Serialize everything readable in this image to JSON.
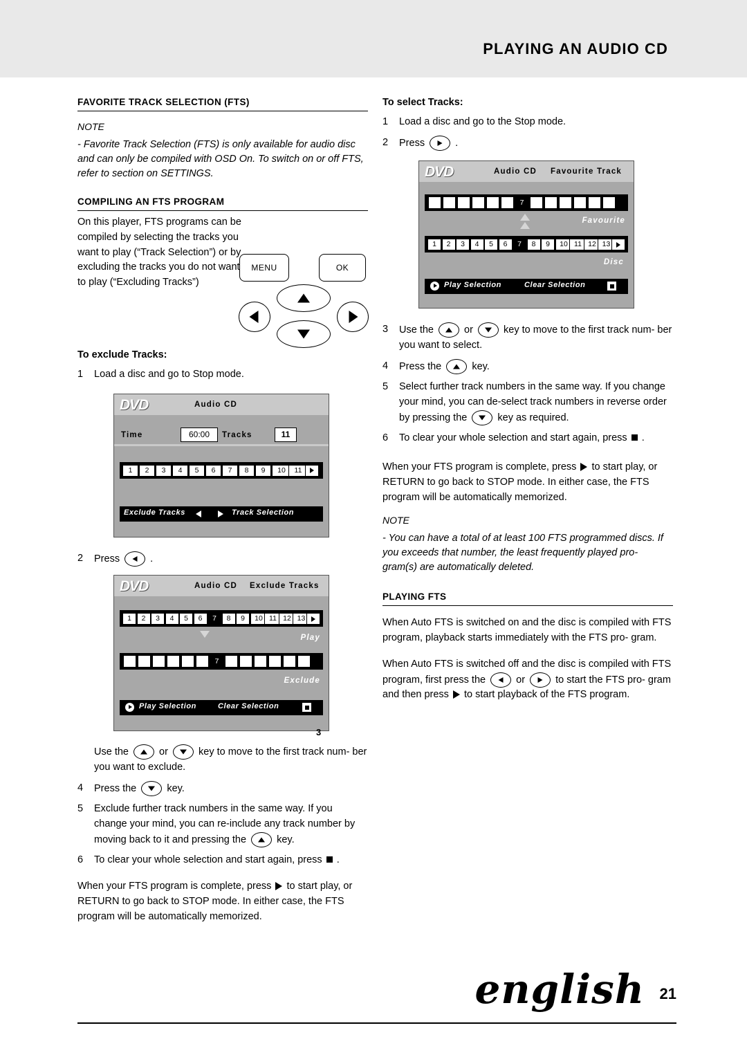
{
  "header": {
    "title": "PLAYING AN AUDIO CD"
  },
  "footer": {
    "language": "english",
    "page": "21"
  },
  "left": {
    "section1_title": "FAVORITE TRACK SELECTION (FTS)",
    "note_label": "NOTE",
    "note_body": "- Favorite Track Selection (FTS) is only available for audio disc and can only be compiled with OSD On. To switch on or off FTS, refer to section on SETTINGS.",
    "section2_title": "COMPILING AN FTS PROGRAM",
    "intro": "On this player, FTS programs can be compiled by selecting the tracks you want to play (“Track Selection”) or by excluding the tracks you do not want to play (“Excluding Tracks”)",
    "remote": {
      "menu": "MENU",
      "ok": "OK"
    },
    "sub1": "To exclude Tracks:",
    "step1_num": "1",
    "step1_text": "Load a disc and go to Stop mode.",
    "step2_num": "2",
    "step2_text": "Press",
    "step2_after": ".",
    "step3_num": "3",
    "step3_a": "Use the",
    "step3_or": "or",
    "step3_b": "key to move to the first track num- ber you want to exclude.",
    "step4_num": "4",
    "step4_a": "Press the",
    "step4_b": "key.",
    "step5_num": "5",
    "step5_a": "Exclude further track numbers in the same way. If you change your mind, you can re-include any track number by moving back to it and pressing the",
    "step5_b": "key.",
    "step6_num": "6",
    "step6_a": "To clear your whole selection and start again, press",
    "step6_b": ".",
    "closing": "When your FTS program is complete, press ▶ to start play, or RETURN to go back to STOP mode. In either case, the FTS program will be automatically memorized.",
    "closing_a": "When your FTS program is complete, press",
    "closing_b": "to start play, or RETURN to go back to STOP mode. In either case, the FTS program will be automatically memorized.",
    "fig_number": "3"
  },
  "right": {
    "sub1": "To select Tracks:",
    "step1_num": "1",
    "step1_text": "Load a disc and go to the Stop mode.",
    "step2_num": "2",
    "step2_text": "Press",
    "step2_after": ".",
    "step3_num": "3",
    "step3_a": "Use the",
    "step3_or": "or",
    "step3_b": "key to move to the first track num- ber you want to select.",
    "step4_num": "4",
    "step4_a": "Press the",
    "step4_b": "key.",
    "step5_num": "5",
    "step5_a": "Select further track numbers in the same way. If you change your mind, you can de-select track numbers in reverse order by pressing the",
    "step5_b": "key as required.",
    "step6_num": "6",
    "step6_a": "To clear your whole selection and start again, press",
    "step6_b": ".",
    "closing_a": "When your FTS program is complete, press",
    "closing_b": "to start play, or RETURN to go back to STOP mode. In either case, the FTS program will be automatically memorized.",
    "note_label": "NOTE",
    "note_body": "- You can have a total of at least 100 FTS programmed discs. If you exceeds that number, the least frequently played pro- gram(s) are automatically deleted.",
    "section_title": "PLAYING FTS",
    "para1": "When Auto FTS is switched on and the disc is compiled with FTS program, playback starts immediately with the FTS pro- gram.",
    "para2_a": "When Auto FTS is switched off and the disc is compiled with FTS program, first press the",
    "para2_or": "or",
    "para2_b": "to start the FTS pro- gram and then press",
    "para2_c": "to start playback of the FTS program."
  },
  "osd1": {
    "title_audio": "Audio CD",
    "time_label": "Time",
    "time_value": "60:00",
    "tracks_label": "Tracks",
    "tracks_value": "11",
    "numbers": [
      "1",
      "2",
      "3",
      "4",
      "5",
      "6",
      "7",
      "8",
      "9",
      "10",
      "11"
    ],
    "bottom_left": "Exclude Tracks",
    "bottom_right": "Track Selection"
  },
  "osd2": {
    "title_audio": "Audio CD",
    "title_mode": "Exclude Tracks",
    "numbers": [
      "1",
      "2",
      "3",
      "4",
      "5",
      "6",
      "7",
      "8",
      "9",
      "10",
      "11",
      "12",
      "13"
    ],
    "highlight": "7",
    "label_play": "Play",
    "label_exclude": "Exclude",
    "bar_value": "7",
    "bottom_left": "Play Selection",
    "bottom_right": "Clear Selection"
  },
  "osd3": {
    "title_audio": "Audio CD",
    "title_mode": "Favourite Track",
    "bar_value": "7",
    "label_favourite": "Favourite",
    "numbers": [
      "1",
      "2",
      "3",
      "4",
      "5",
      "6",
      "7",
      "8",
      "9",
      "10",
      "11",
      "12",
      "13"
    ],
    "highlight": "7",
    "label_disc": "Disc",
    "bottom_left": "Play Selection",
    "bottom_right": "Clear Selection"
  }
}
